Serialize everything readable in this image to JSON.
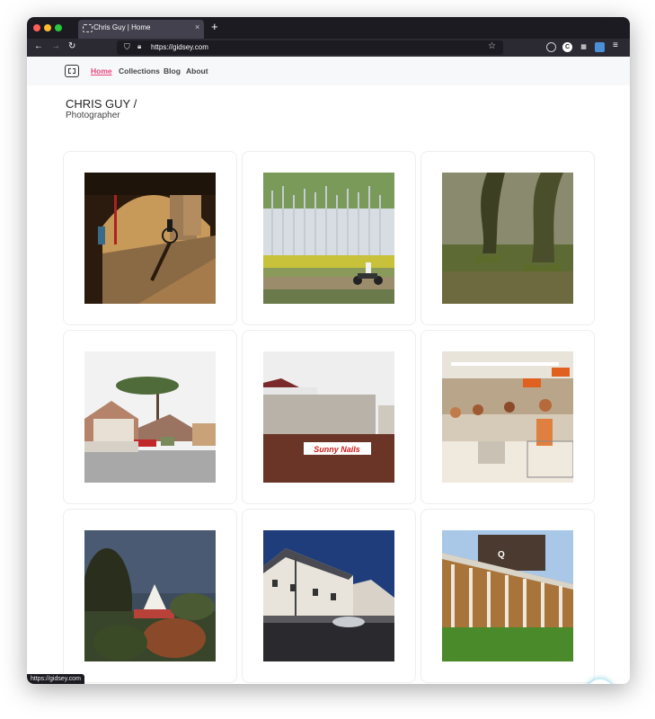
{
  "browser": {
    "tab_title": "Chris Guy | Home",
    "tab_close": "×",
    "new_tab": "+",
    "url": "https://gidsey.com",
    "status_url": "https://gidsey.com"
  },
  "nav": {
    "items": [
      {
        "label": "Home",
        "active": true
      },
      {
        "label": "Collections",
        "active": false
      },
      {
        "label": "Blog",
        "active": false
      },
      {
        "label": "About",
        "active": false
      }
    ]
  },
  "header": {
    "name": "CHRIS GUY /",
    "role": "Photographer"
  },
  "gallery": {
    "photos": [
      {
        "subject": "cyclist under railway arch"
      },
      {
        "subject": "motorcyclist by tall tree plantation"
      },
      {
        "subject": "mossy woodland trees"
      },
      {
        "subject": "suburban houses with pine tree"
      },
      {
        "subject": "wall with Sunny Nails sign",
        "sign_text": "Sunny Nails"
      },
      {
        "subject": "retro supermarket checkout"
      },
      {
        "subject": "church spire at dusk"
      },
      {
        "subject": "new terraced houses at sunset"
      },
      {
        "subject": "brick building with Q logo",
        "logo_text": "Q"
      }
    ]
  },
  "colors": {
    "accent": "#e8467c",
    "browser_chrome": "#1c1b22",
    "nav_background": "#f7f8fa"
  }
}
